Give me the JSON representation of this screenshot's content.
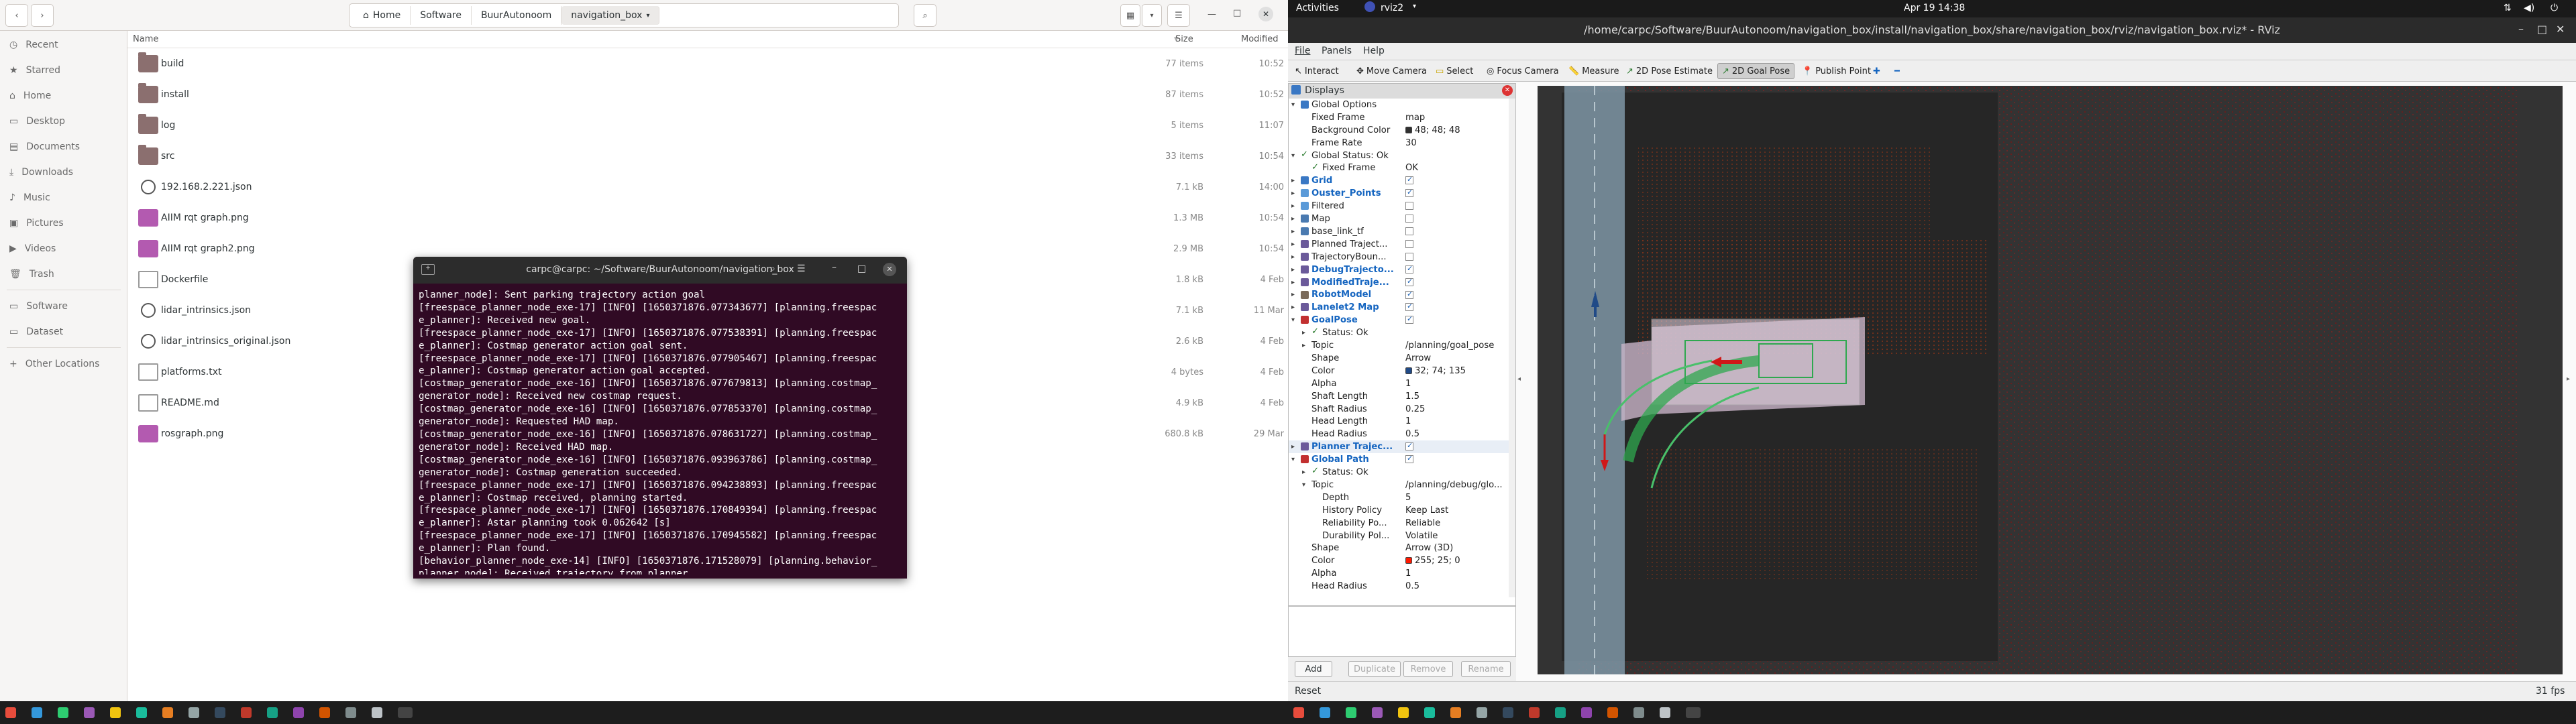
{
  "file_manager": {
    "breadcrumb": [
      "Home",
      "Software",
      "BuurAutonoom",
      "navigation_box"
    ],
    "sidebar": {
      "places": [
        "Recent",
        "Starred",
        "Home",
        "Desktop",
        "Documents",
        "Downloads",
        "Music",
        "Pictures",
        "Videos",
        "Trash"
      ],
      "devices": [
        "Software",
        "Dataset"
      ],
      "other": "Other Locations"
    },
    "columns": {
      "name": "Name",
      "size": "Size",
      "modified": "Modified"
    },
    "files": [
      {
        "name": "build",
        "size": "77 items",
        "modified": "10:52",
        "kind": "folder"
      },
      {
        "name": "install",
        "size": "87 items",
        "modified": "10:52",
        "kind": "folder"
      },
      {
        "name": "log",
        "size": "5 items",
        "modified": "11:07",
        "kind": "folder"
      },
      {
        "name": "src",
        "size": "33 items",
        "modified": "10:54",
        "kind": "folder"
      },
      {
        "name": "192.168.2.221.json",
        "size": "7.1 kB",
        "modified": "14:00",
        "kind": "json"
      },
      {
        "name": "AIIM rqt graph.png",
        "size": "1.3 MB",
        "modified": "10:54",
        "kind": "image"
      },
      {
        "name": "AIIM rqt graph2.png",
        "size": "2.9 MB",
        "modified": "10:54",
        "kind": "image"
      },
      {
        "name": "Dockerfile",
        "size": "1.8 kB",
        "modified": "4 Feb",
        "kind": "doc"
      },
      {
        "name": "lidar_intrinsics.json",
        "size": "7.1 kB",
        "modified": "11 Mar",
        "kind": "json"
      },
      {
        "name": "lidar_intrinsics_original.json",
        "size": "2.6 kB",
        "modified": "4 Feb",
        "kind": "json"
      },
      {
        "name": "platforms.txt",
        "size": "4 bytes",
        "modified": "4 Feb",
        "kind": "doc"
      },
      {
        "name": "README.md",
        "size": "4.9 kB",
        "modified": "4 Feb",
        "kind": "doc"
      },
      {
        "name": "rosgraph.png",
        "size": "680.8 kB",
        "modified": "29 Mar",
        "kind": "image"
      }
    ]
  },
  "terminal": {
    "title": "carpc@carpc: ~/Software/BuurAutonoom/navigation_box",
    "lines": [
      "planner_node]: Sent parking trajectory action goal",
      "[freespace_planner_node_exe-17] [INFO] [1650371876.077343677] [planning.freespac",
      "e_planner]: Received new goal.",
      "[freespace_planner_node_exe-17] [INFO] [1650371876.077538391] [planning.freespac",
      "e_planner]: Costmap generator action goal sent.",
      "[freespace_planner_node_exe-17] [INFO] [1650371876.077905467] [planning.freespac",
      "e_planner]: Costmap generator action goal accepted.",
      "[costmap_generator_node_exe-16] [INFO] [1650371876.077679813] [planning.costmap_",
      "generator_node]: Received new costmap request.",
      "[costmap_generator_node_exe-16] [INFO] [1650371876.077853370] [planning.costmap_",
      "generator_node]: Requested HAD map.",
      "[costmap_generator_node_exe-16] [INFO] [1650371876.078631727] [planning.costmap_",
      "generator_node]: Received HAD map.",
      "[costmap_generator_node_exe-16] [INFO] [1650371876.093963786] [planning.costmap_",
      "generator_node]: Costmap generation succeeded.",
      "[freespace_planner_node_exe-17] [INFO] [1650371876.094238893] [planning.freespac",
      "e_planner]: Costmap received, planning started.",
      "[freespace_planner_node_exe-17] [INFO] [1650371876.170849394] [planning.freespac",
      "e_planner]: Astar planning took 0.062642 [s]",
      "[freespace_planner_node_exe-17] [INFO] [1650371876.170945582] [planning.freespac",
      "e_planner]: Plan found.",
      "[behavior_planner_node_exe-14] [INFO] [1650371876.171528079] [planning.behavior_",
      "planner_node]: Received trajectory from planner"
    ]
  },
  "topbar": {
    "activities": "Activities",
    "app": "rviz2",
    "clock": "Apr 19  14:38"
  },
  "rviz": {
    "title": "/home/carpc/Software/BuurAutonoom/navigation_box/install/navigation_box/share/navigation_box/rviz/navigation_box.rviz* - RViz",
    "menu": [
      "File",
      "Panels",
      "Help"
    ],
    "tools": [
      "Interact",
      "Move Camera",
      "Select",
      "Focus Camera",
      "Measure",
      "2D Pose Estimate",
      "2D Goal Pose",
      "Publish Point"
    ],
    "active_tool": "2D Goal Pose",
    "displays_title": "Displays",
    "tree": [
      {
        "label": "Global Options",
        "indent": 1,
        "arrow": "▾",
        "icon": "gear"
      },
      {
        "label": "Fixed Frame",
        "indent": 2,
        "value": "map"
      },
      {
        "label": "Background Color",
        "indent": 2,
        "value": "48; 48; 48",
        "swatch": "#303030"
      },
      {
        "label": "Frame Rate",
        "indent": 2,
        "value": "30"
      },
      {
        "label": "Global Status: Ok",
        "indent": 1,
        "arrow": "▾",
        "icon": "ok"
      },
      {
        "label": "Fixed Frame",
        "indent": 2,
        "value": "OK",
        "icon": "ok"
      },
      {
        "label": "Grid",
        "indent": 1,
        "arrow": "▸",
        "icon": "grid",
        "check": true,
        "bold": true
      },
      {
        "label": "Ouster_Points",
        "indent": 1,
        "arrow": "▸",
        "icon": "points",
        "check": true,
        "bold": true
      },
      {
        "label": "Filtered",
        "indent": 1,
        "arrow": "▸",
        "icon": "points",
        "check": false
      },
      {
        "label": "Map",
        "indent": 1,
        "arrow": "▸",
        "icon": "map",
        "check": false
      },
      {
        "label": "base_link_tf",
        "indent": 1,
        "arrow": "▸",
        "icon": "tf",
        "check": false
      },
      {
        "label": "Planned Traject...",
        "indent": 1,
        "arrow": "▸",
        "icon": "marker",
        "check": false
      },
      {
        "label": "TrajectoryBoun...",
        "indent": 1,
        "arrow": "▸",
        "icon": "marker",
        "check": false
      },
      {
        "label": "DebugTrajecto...",
        "indent": 1,
        "arrow": "▸",
        "icon": "marker",
        "check": true,
        "bold": true
      },
      {
        "label": "ModifiedTraje...",
        "indent": 1,
        "arrow": "▸",
        "icon": "marker",
        "check": true,
        "bold": true
      },
      {
        "label": "RobotModel",
        "indent": 1,
        "arrow": "▸",
        "icon": "robot",
        "check": true,
        "bold": true
      },
      {
        "label": "Lanelet2 Map",
        "indent": 1,
        "arrow": "▸",
        "icon": "marker",
        "check": true,
        "bold": true
      },
      {
        "label": "GoalPose",
        "indent": 1,
        "arrow": "▾",
        "icon": "pose",
        "check": true,
        "bold": true
      },
      {
        "label": "Status: Ok",
        "indent": 2,
        "arrow": "▸",
        "icon": "ok"
      },
      {
        "label": "Topic",
        "indent": 2,
        "arrow": "▸",
        "value": "/planning/goal_pose"
      },
      {
        "label": "Shape",
        "indent": 2,
        "value": "Arrow"
      },
      {
        "label": "Color",
        "indent": 2,
        "value": "32; 74; 135",
        "swatch": "#204a87"
      },
      {
        "label": "Alpha",
        "indent": 2,
        "value": "1"
      },
      {
        "label": "Shaft Length",
        "indent": 2,
        "value": "1.5"
      },
      {
        "label": "Shaft Radius",
        "indent": 2,
        "value": "0.25"
      },
      {
        "label": "Head Length",
        "indent": 2,
        "value": "1"
      },
      {
        "label": "Head Radius",
        "indent": 2,
        "value": "0.5"
      },
      {
        "label": "Planner Trajec...",
        "indent": 1,
        "arrow": "▸",
        "icon": "marker",
        "check": true,
        "bold": true
      },
      {
        "label": "Global Path",
        "indent": 1,
        "arrow": "▾",
        "icon": "path",
        "check": true,
        "bold": true
      },
      {
        "label": "Status: Ok",
        "indent": 2,
        "arrow": "▸",
        "icon": "ok"
      },
      {
        "label": "Topic",
        "indent": 2,
        "arrow": "▾",
        "value": "/planning/debug/glo..."
      },
      {
        "label": "Depth",
        "indent": 3,
        "value": "5"
      },
      {
        "label": "History Policy",
        "indent": 3,
        "value": "Keep Last"
      },
      {
        "label": "Reliability Po...",
        "indent": 3,
        "value": "Reliable"
      },
      {
        "label": "Durability Pol...",
        "indent": 3,
        "value": "Volatile"
      },
      {
        "label": "Shape",
        "indent": 2,
        "value": "Arrow (3D)"
      },
      {
        "label": "Color",
        "indent": 2,
        "value": "255; 25; 0",
        "swatch": "#ff1900"
      },
      {
        "label": "Alpha",
        "indent": 2,
        "value": "1"
      },
      {
        "label": "Head Radius",
        "indent": 2,
        "value": "0.5"
      }
    ],
    "buttons": {
      "add": "Add",
      "duplicate": "Duplicate",
      "remove": "Remove",
      "rename": "Rename"
    },
    "reset": "Reset",
    "fps": "31 fps"
  }
}
